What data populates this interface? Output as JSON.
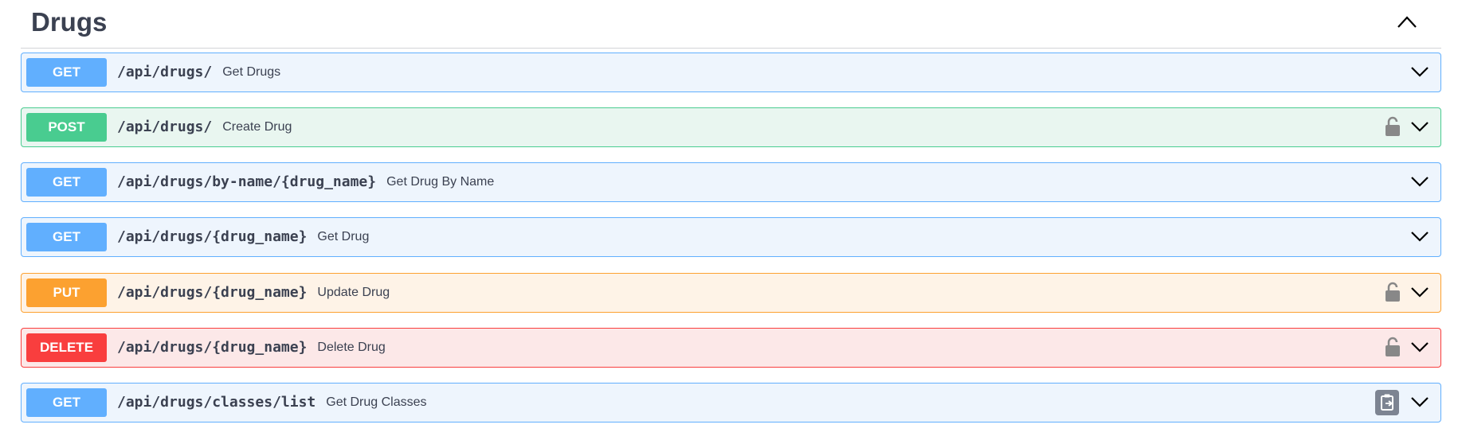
{
  "section": {
    "title": "Drugs"
  },
  "operations": [
    {
      "method": "GET",
      "path": "/api/drugs/",
      "summary": "Get Drugs"
    },
    {
      "method": "POST",
      "path": "/api/drugs/",
      "summary": "Create Drug"
    },
    {
      "method": "GET",
      "path": "/api/drugs/by-name/{drug_name}",
      "summary": "Get Drug By Name"
    },
    {
      "method": "GET",
      "path": "/api/drugs/{drug_name}",
      "summary": "Get Drug"
    },
    {
      "method": "PUT",
      "path": "/api/drugs/{drug_name}",
      "summary": "Update Drug"
    },
    {
      "method": "DELETE",
      "path": "/api/drugs/{drug_name}",
      "summary": "Delete Drug"
    },
    {
      "method": "GET",
      "path": "/api/drugs/classes/list",
      "summary": "Get Drug Classes"
    }
  ],
  "colors": {
    "get": "#61affe",
    "post": "#49cc90",
    "put": "#fca130",
    "delete": "#f93e3e",
    "text": "#3b4151"
  },
  "icons": {
    "collapse": "chevron-up-icon",
    "expand": "chevron-down-icon",
    "lock": "lock-icon",
    "copy": "clipboard-copy-icon"
  }
}
